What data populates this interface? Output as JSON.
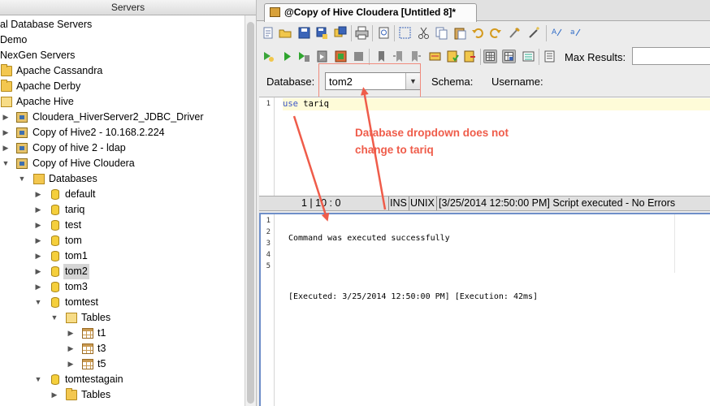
{
  "left_panel": {
    "title": "Servers",
    "tree": [
      {
        "label": "al Database Servers"
      },
      {
        "label": "Demo"
      },
      {
        "label": "NexGen Servers"
      },
      {
        "label": "Apache Cassandra"
      },
      {
        "label": "Apache Derby"
      },
      {
        "label": "Apache Hive"
      },
      {
        "label": "Cloudera_HiverServer2_JDBC_Driver"
      },
      {
        "label": "Copy of Hive2 - 10.168.2.224"
      },
      {
        "label": "Copy of hive 2 - ldap"
      },
      {
        "label": "Copy of Hive Cloudera"
      },
      {
        "label": "Databases"
      },
      {
        "label": "default"
      },
      {
        "label": "tariq"
      },
      {
        "label": "test"
      },
      {
        "label": "tom"
      },
      {
        "label": "tom1"
      },
      {
        "label": "tom2"
      },
      {
        "label": "tom3"
      },
      {
        "label": "tomtest"
      },
      {
        "label": "Tables"
      },
      {
        "label": "t1"
      },
      {
        "label": "t3"
      },
      {
        "label": "t5"
      },
      {
        "label": "tomtestagain"
      },
      {
        "label": "Tables"
      }
    ]
  },
  "tab": {
    "title": "@Copy of Hive Cloudera [Untitled 8]*"
  },
  "toolbar": {
    "max_results_label": "Max Results:",
    "max_results_value": ""
  },
  "connection_bar": {
    "database_label": "Database:",
    "database_value": "tom2",
    "schema_label": "Schema:",
    "username_label": "Username:"
  },
  "editor": {
    "line_number": "1",
    "code_keyword": "use",
    "code_rest": "tariq"
  },
  "status_bar": {
    "position": "1 | 10 : 0",
    "mode": "INS",
    "line_endings": "UNIX",
    "message": "[3/25/2014 12:50:00 PM] Script executed - No Errors"
  },
  "output": {
    "line_numbers": [
      "1",
      "2",
      "3",
      "4",
      "5"
    ],
    "lines": [
      "Command was executed successfully",
      "",
      "[Executed: 3/25/2014 12:50:00 PM] [Execution: 42ms]",
      "",
      ""
    ]
  },
  "annotation": {
    "line1": "Database dropdown does not",
    "line2": "change to tariq",
    "color": "#ef5c4a"
  }
}
